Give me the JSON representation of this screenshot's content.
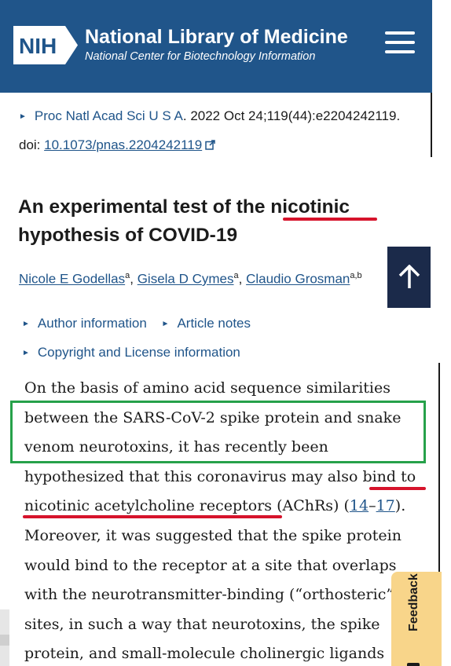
{
  "header": {
    "logo_text": "NIH",
    "title": "National Library of Medicine",
    "subtitle": "National Center for Biotechnology Information",
    "menu_icon": "hamburger-menu-icon",
    "brand_color": "#20558a"
  },
  "citation": {
    "journal": "Proc Natl Acad Sci U S A",
    "details": ". 2022 Oct 24;119(44):e2204242119.",
    "doi_label": "doi: ",
    "doi_value": "10.1073/pnas.2204242119"
  },
  "article": {
    "title_part1": "An experimental test of the ",
    "title_highlight": "nicotinic",
    "title_line2": "hypothesis of COVID-19",
    "authors": [
      {
        "name": "Nicole E Godellas",
        "affil": "a"
      },
      {
        "name": "Gisela D Cymes",
        "affil": "a"
      },
      {
        "name": "Claudio Grosman",
        "affil": "a,b"
      }
    ],
    "author_info": "Author information",
    "article_notes": "Article notes",
    "copyright": "Copyright and License information"
  },
  "abstract": {
    "l1": "On the basis of amino acid sequence similarities",
    "l2": "between the SARS-CoV-2 spike protein and snake",
    "l3": "venom neurotoxins, it has recently been",
    "l4a": "hypothesized that this coronavirus may also ",
    "l4b": "bind to",
    "l5a": "nicotinic acetylcholine receptors",
    "l5b": " (AChRs) (",
    "ref1": "14",
    "dash": "–",
    "ref2": "17",
    "l5c": ").",
    "l6": "Moreover, it was suggested that the spike protein",
    "l7": "would bind to the receptor at a site that overlaps",
    "l8": "with the neurotransmitter-binding (“orthosteric”)",
    "l9": "sites, in such a way that neurotoxins, the spike",
    "l10": "protein, and small-molecule cholinergic ligands"
  },
  "feedback": {
    "label": "Feedback",
    "color": "#f8d58a"
  },
  "annotations": {
    "red": "#d6132b",
    "green": "#26a14a"
  }
}
